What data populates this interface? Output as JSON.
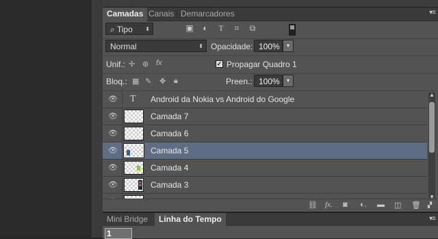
{
  "layers_panel": {
    "tabs": [
      {
        "label": "Camadas",
        "active": true
      },
      {
        "label": "Canais",
        "active": false
      },
      {
        "label": "Demarcadores",
        "active": false
      }
    ],
    "filter": {
      "type_label": "Tipo",
      "icons": [
        "image-filter-icon",
        "adjustment-filter-icon",
        "type-filter-icon",
        "shape-filter-icon",
        "smart-object-filter-icon"
      ]
    },
    "blend_mode": "Normal",
    "opacity_label": "Opacidade:",
    "opacity_value": "100%",
    "unify_label": "Unif.:",
    "propagate_label": "Propagar Quadro 1",
    "propagate_checked": true,
    "lock_label": "Bloq.:",
    "fill_label": "Preen.:",
    "fill_value": "100%",
    "layers": [
      {
        "name": "Android da Nokia vs Android do Google",
        "kind": "text",
        "selected": false
      },
      {
        "name": "Camada 7",
        "kind": "pixel",
        "selected": false
      },
      {
        "name": "Camada 6",
        "kind": "pixel",
        "selected": false
      },
      {
        "name": "Camada 5",
        "kind": "pixel",
        "selected": true
      },
      {
        "name": "Camada 4",
        "kind": "pixel",
        "selected": false
      },
      {
        "name": "Camada 3",
        "kind": "pixel",
        "selected": false
      },
      {
        "name": "",
        "kind": "pixel",
        "selected": false
      }
    ],
    "footer_icons": [
      "link-icon",
      "fx-icon",
      "mask-icon",
      "adjustment-layer-icon",
      "group-folder-icon",
      "new-layer-icon",
      "trash-icon"
    ]
  },
  "timeline_panel": {
    "tabs": [
      {
        "label": "Mini Bridge",
        "active": false
      },
      {
        "label": "Linha do Tempo",
        "active": true
      }
    ],
    "frame_number": "1"
  },
  "colors": {
    "selected_layer": "#5f6e84",
    "panel_bg": "#535353",
    "tab_bar": "#3a3a3a"
  }
}
